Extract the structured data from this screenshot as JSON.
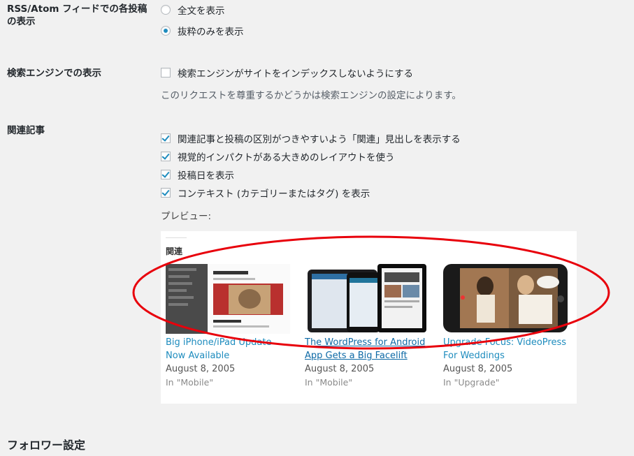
{
  "feed": {
    "label": "RSS/Atom フィードでの各投稿の表示",
    "options": [
      {
        "label": "全文を表示",
        "checked": false
      },
      {
        "label": "抜粋のみを表示",
        "checked": true
      }
    ]
  },
  "search": {
    "label": "検索エンジンでの表示",
    "checkbox_label": "検索エンジンがサイトをインデックスしないようにする",
    "description": "このリクエストを尊重するかどうかは検索エンジンの設定によります。"
  },
  "related": {
    "label": "関連記事",
    "options": [
      {
        "label": "関連記事と投稿の区別がつきやすいよう「関連」見出しを表示する",
        "checked": true
      },
      {
        "label": "視覚的インパクトがある大きめのレイアウトを使う",
        "checked": true
      },
      {
        "label": "投稿日を表示",
        "checked": true
      },
      {
        "label": "コンテキスト (カテゴリーまたはタグ) を表示",
        "checked": true
      }
    ],
    "preview_label": "プレビュー:",
    "preview": {
      "heading": "関連",
      "posts": [
        {
          "title": "Big iPhone/iPad Update Now Available",
          "date": "August 8, 2005",
          "context": "In \"Mobile\""
        },
        {
          "title": "The WordPress for Android App Gets a Big Facelift",
          "date": "August 8, 2005",
          "context": "In \"Mobile\""
        },
        {
          "title": "Upgrade Focus: VideoPress For Weddings",
          "date": "August 8, 2005",
          "context": "In \"Upgrade\""
        }
      ]
    }
  },
  "followers": {
    "heading": "フォロワー設定"
  },
  "colors": {
    "accent": "#1e8cbe",
    "annotation": "#e8000b"
  }
}
